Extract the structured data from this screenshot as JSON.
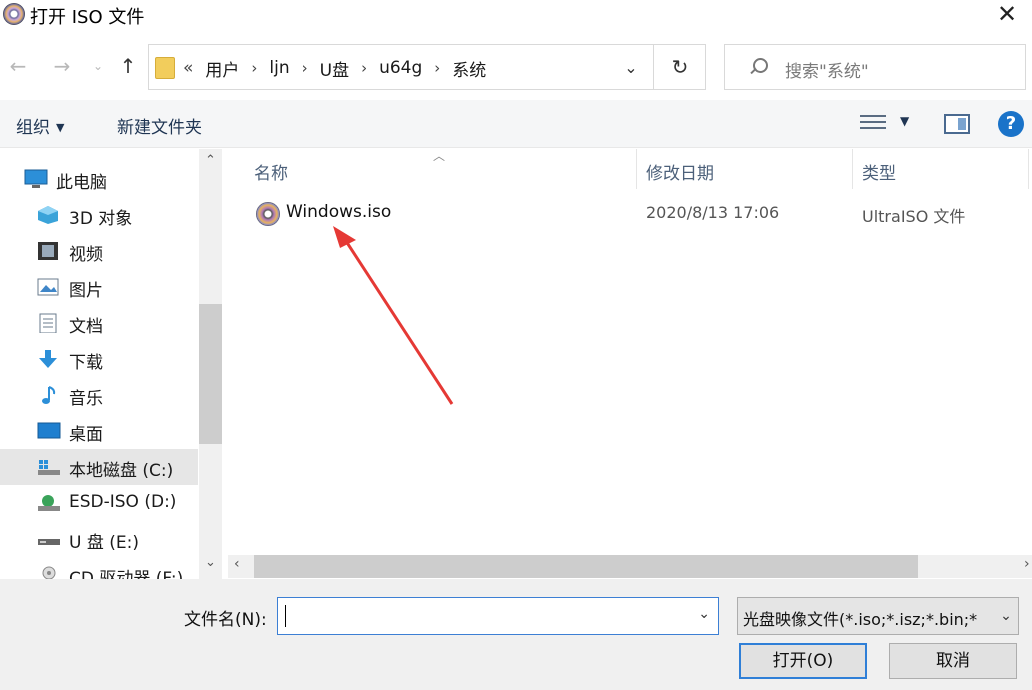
{
  "window": {
    "title": "打开 ISO 文件",
    "close_glyph": "✕"
  },
  "address": {
    "lead": "«",
    "crumbs": [
      "用户",
      "ljn",
      "U盘",
      "u64g",
      "系统"
    ],
    "separator": "›"
  },
  "search": {
    "placeholder": "搜索\"系统\""
  },
  "toolbar": {
    "organize_label": "组织",
    "newfolder_label": "新建文件夹",
    "help_label": "?"
  },
  "nav": {
    "items": [
      {
        "label": "此电脑",
        "icon": "computer-icon"
      },
      {
        "label": "3D 对象",
        "icon": "cube-icon"
      },
      {
        "label": "视频",
        "icon": "film-icon"
      },
      {
        "label": "图片",
        "icon": "picture-icon"
      },
      {
        "label": "文档",
        "icon": "document-icon"
      },
      {
        "label": "下载",
        "icon": "download-icon"
      },
      {
        "label": "音乐",
        "icon": "music-note-icon"
      },
      {
        "label": "桌面",
        "icon": "desktop-icon"
      },
      {
        "label": "本地磁盘 (C:)",
        "icon": "drive-icon"
      },
      {
        "label": "ESD-ISO (D:)",
        "icon": "drive-icon"
      },
      {
        "label": "U 盘 (E:)",
        "icon": "usb-drive-icon"
      },
      {
        "label": "CD 驱动器 (F:)",
        "icon": "cd-drive-icon"
      }
    ],
    "selected_index": 8
  },
  "filelist": {
    "columns": [
      "名称",
      "修改日期",
      "类型"
    ],
    "rows": [
      {
        "name": "Windows.iso",
        "date": "2020/8/13 17:06",
        "type": "UltraISO 文件"
      }
    ]
  },
  "bottom": {
    "filename_label": "文件名(N):",
    "filename_value": "",
    "filter_value": "光盘映像文件(*.iso;*.isz;*.bin;*",
    "open_label": "打开(O)",
    "cancel_label": "取消"
  },
  "colors": {
    "accent": "#2f7fd7",
    "annotation_arrow": "#e53935",
    "selected_bg": "#e6e6e6"
  }
}
